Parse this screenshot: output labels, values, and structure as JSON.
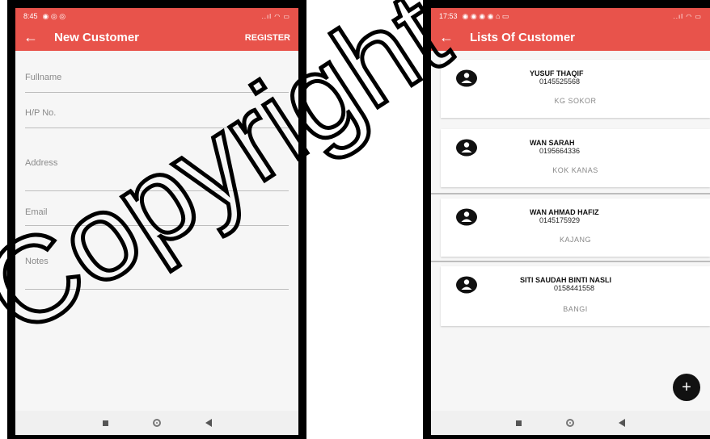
{
  "left_phone": {
    "status": {
      "time": "8:45",
      "icons": "◉ ◎ ◎",
      "right": "..ıl ◠ ▭"
    },
    "appbar": {
      "back": "←",
      "title": "New Customer",
      "action": "REGISTER"
    },
    "fields": [
      {
        "placeholder": "Fullname"
      },
      {
        "placeholder": "H/P No."
      },
      {
        "placeholder": "Address"
      },
      {
        "placeholder": "Email"
      },
      {
        "placeholder": "Notes"
      }
    ]
  },
  "right_phone": {
    "status": {
      "time": "17:53",
      "icons": "◉ ◉ ◉ ◉ ⌂ ▭",
      "right": "..ıl ◠ ▭"
    },
    "appbar": {
      "back": "←",
      "title": "Lists Of Customer"
    },
    "customers": [
      {
        "name": "YUSUF THAQIF",
        "phone": "0145525568",
        "address": "KG SOKOR"
      },
      {
        "name": "WAN SARAH",
        "phone": "0195664336",
        "address": "KOK KANAS"
      },
      {
        "name": "WAN AHMAD HAFIZ",
        "phone": "0145175929",
        "address": "KAJANG"
      },
      {
        "name": "SITI SAUDAH BINTI NASLI",
        "phone": "0158441558",
        "address": "BANGI"
      }
    ],
    "fab": "+"
  },
  "watermark": {
    "text": "Copyright"
  },
  "colors": {
    "appbar": "#e8534b",
    "fab": "#111111"
  }
}
